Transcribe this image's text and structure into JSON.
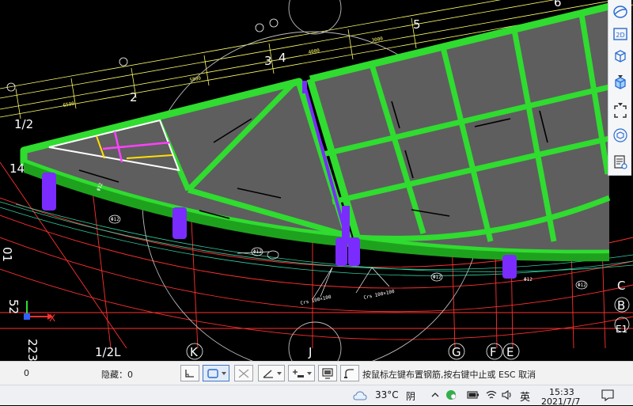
{
  "drawing": {
    "axis_letters": [
      "1/2L",
      "K",
      "J",
      "G",
      "F",
      "E"
    ],
    "axis_numbers": [
      "1/2",
      "2",
      "3",
      "4",
      "5",
      "6"
    ],
    "left_edge_labels": [
      "14",
      "52",
      "01",
      "223"
    ],
    "ucs": {
      "x_label": "X"
    },
    "right_edge_labels": [
      "C",
      "B",
      "E1"
    ],
    "dim_values": [
      "6590",
      "5800",
      "4000",
      "3000"
    ],
    "rebar_tags": [
      "Φ12",
      "Φ12",
      "Φ12",
      "Φ12",
      "Φ12",
      "Φ12"
    ],
    "section_tags": [
      "Crs 100×100",
      "Crs 100×100"
    ]
  },
  "view_toolbar": {
    "buttons": [
      {
        "name": "orbit-view",
        "icon": "orbit-icon"
      },
      {
        "name": "2d-view",
        "label": "2D",
        "icon": "2d-icon"
      },
      {
        "name": "3d-view",
        "icon": "cube-icon"
      },
      {
        "name": "shaded-view",
        "icon": "shaded-cube-icon"
      },
      {
        "name": "zoom-extents",
        "icon": "frame-corners-icon"
      },
      {
        "name": "dynamic-observe",
        "icon": "sphere-cube-icon"
      },
      {
        "name": "properties",
        "icon": "list-eye-icon"
      }
    ]
  },
  "statusbar": {
    "count": "0",
    "hidden_label": "隐藏：0",
    "hint": "按鼠标左键布置钢筋,按右键中止或 ESC 取消"
  },
  "taskbar": {
    "temperature": "33°C",
    "weather": "阴",
    "ime": "英",
    "time": "15:33",
    "date": "2021/7/7"
  },
  "colors": {
    "slab_edge": "#2fdc2f",
    "column": "#7a2cff",
    "axis_grid": "#ff3030",
    "dimension": "#ffff66",
    "selection": "#ffe000",
    "highlight": "#ff40ff"
  }
}
